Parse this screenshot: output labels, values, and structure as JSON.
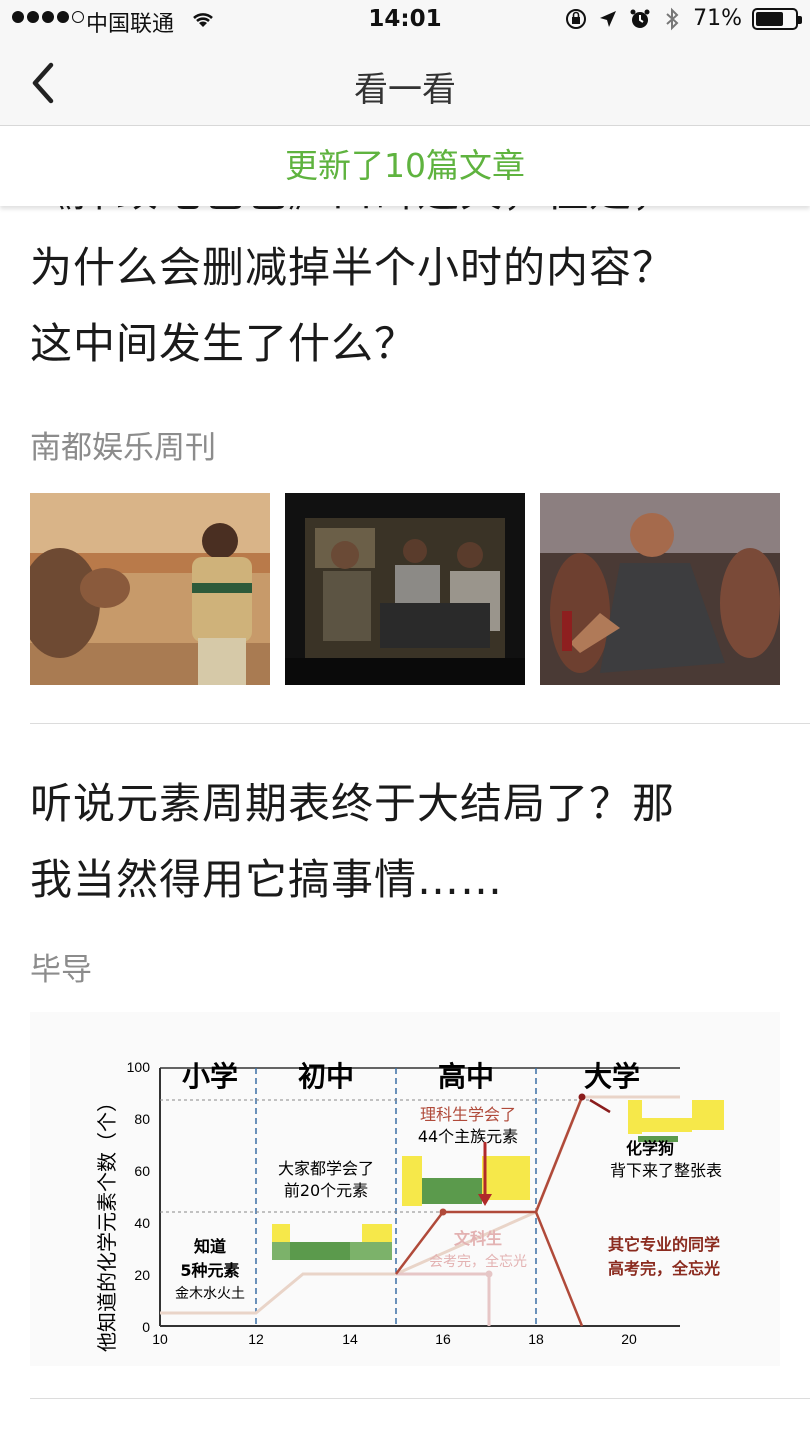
{
  "status_bar": {
    "carrier": "中国联通",
    "time": "14:01",
    "battery": "71%",
    "battery_level": 0.71
  },
  "nav": {
    "title": "看一看"
  },
  "banner": {
    "text": "更新了10篇文章"
  },
  "articles": [
    {
      "title_lines": [
        "《摔跤吧爸爸》口碑逆天，但是，",
        "为什么会删减掉半个小时的内容？",
        "这中间发生了什么？"
      ],
      "source": "南都娱乐周刊"
    },
    {
      "title_lines": [
        "听说元素周期表终于大结局了？那",
        "我当然得用它搞事情……"
      ],
      "source": "毕导"
    }
  ],
  "chart_data": {
    "type": "line",
    "ylabel": "他知道的化学元素个数（个）",
    "x_ticks": [
      "10",
      "12",
      "14",
      "16",
      "18",
      "20"
    ],
    "y_ticks": [
      "0",
      "20",
      "40",
      "60",
      "80",
      "100"
    ],
    "stages": [
      "小学",
      "初中",
      "高中",
      "大学"
    ],
    "annotations": {
      "primary_a": "知道",
      "primary_b": "5种元素",
      "primary_c": "金木水火土",
      "middle_a": "大家都学会了",
      "middle_b": "前20个元素",
      "science_a": "理科生学会了",
      "science_b": "44个主族元素",
      "arts_a": "文科生",
      "arts_b": "会考完，全忘光",
      "chem_a": "化学狗",
      "chem_b": "背下来了整张表",
      "other_a": "其它专业的同学",
      "other_b": "高考完，全忘光"
    },
    "series": [
      {
        "x": [
          10,
          12,
          13,
          15,
          18,
          19,
          20
        ],
        "y": [
          5,
          5,
          20,
          20,
          44,
          88,
          88
        ]
      },
      {
        "x": [
          15,
          17,
          17
        ],
        "y": [
          20,
          20,
          0
        ]
      },
      {
        "x": [
          15,
          16,
          18,
          19
        ],
        "y": [
          20,
          44,
          44,
          0
        ]
      }
    ],
    "ylim": [
      0,
      100
    ],
    "xlim": [
      10,
      22
    ]
  }
}
